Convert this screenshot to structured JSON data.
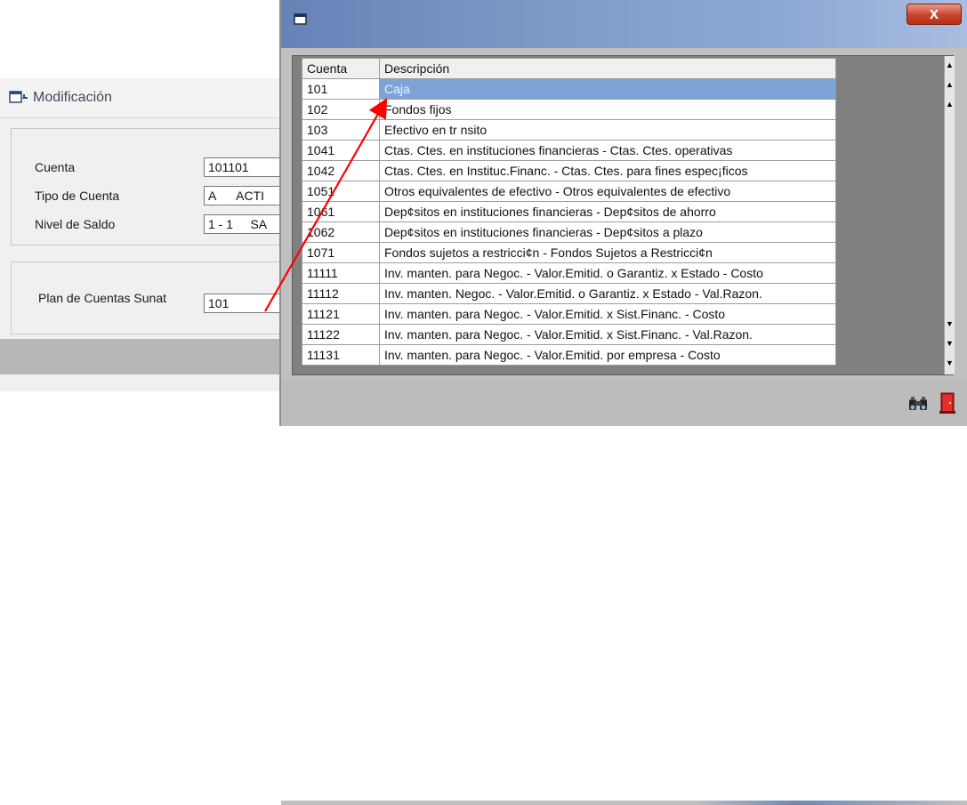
{
  "modificacion": {
    "title": "Modificación",
    "fields": {
      "cuenta_label": "Cuenta",
      "cuenta_value": "101101",
      "tipo_label": "Tipo de Cuenta",
      "tipo_value": "A      ACTI",
      "nivel_label": "Nivel de Saldo",
      "nivel_value": "1 - 1     SA",
      "sunat_label": "Plan de Cuentas Sunat",
      "sunat_value": "101"
    }
  },
  "popup": {
    "close_label": "x",
    "columns": [
      "Cuenta",
      "Descripción"
    ],
    "rows": [
      {
        "cuenta": "101",
        "descripcion": "Caja",
        "selected": true
      },
      {
        "cuenta": "102",
        "descripcion": "Fondos fijos"
      },
      {
        "cuenta": "103",
        "descripcion": "Efectivo en tr nsito"
      },
      {
        "cuenta": "1041",
        "descripcion": "Ctas. Ctes. en instituciones financieras - Ctas. Ctes. operativas"
      },
      {
        "cuenta": "1042",
        "descripcion": "Ctas. Ctes. en Instituc.Financ. - Ctas. Ctes. para fines espec¡ficos"
      },
      {
        "cuenta": "1051",
        "descripcion": "Otros equivalentes de efectivo - Otros equivalentes de efectivo"
      },
      {
        "cuenta": "1061",
        "descripcion": "Dep¢sitos en instituciones financieras - Dep¢sitos de ahorro"
      },
      {
        "cuenta": "1062",
        "descripcion": "Dep¢sitos en instituciones financieras - Dep¢sitos a plazo"
      },
      {
        "cuenta": "1071",
        "descripcion": "Fondos sujetos a restricci¢n - Fondos Sujetos a Restricci¢n"
      },
      {
        "cuenta": "11111",
        "descripcion": "Inv. manten. para Negoc. - Valor.Emitid. o Garantiz. x Estado - Costo"
      },
      {
        "cuenta": "11112",
        "descripcion": "Inv. manten. Negoc. - Valor.Emitid. o Garantiz. x Estado - Val.Razon."
      },
      {
        "cuenta": "11121",
        "descripcion": "Inv. manten. para Negoc. - Valor.Emitid. x Sist.Financ. - Costo"
      },
      {
        "cuenta": "11122",
        "descripcion": "Inv. manten. para Negoc. - Valor.Emitid. x Sist.Financ. - Val.Razon."
      },
      {
        "cuenta": "11131",
        "descripcion": "Inv. manten. para Negoc. - Valor.Emitid. por empresa - Costo"
      }
    ],
    "toolbar": {
      "find_icon": "binoculars-icon",
      "exit_icon": "exit-door-icon"
    }
  },
  "colors": {
    "selection": "#7da4d8",
    "arrow": "#ff0000",
    "titlebar": "#7f9ac8",
    "close": "#c9432c"
  }
}
